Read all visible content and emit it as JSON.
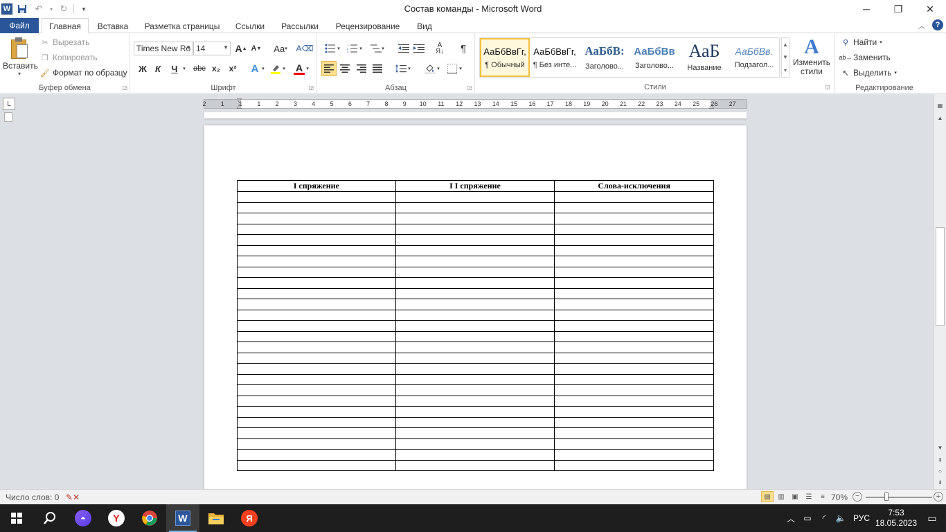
{
  "window": {
    "title": "Состав команды  -  Microsoft Word",
    "app_icon": "W",
    "controls": [
      "minimize",
      "restore",
      "close"
    ]
  },
  "tabs": {
    "file": "Файл",
    "items": [
      "Главная",
      "Вставка",
      "Разметка страницы",
      "Ссылки",
      "Рассылки",
      "Рецензирование",
      "Вид"
    ],
    "active": "Главная"
  },
  "ribbon": {
    "clipboard": {
      "label": "Буфер обмена",
      "paste": "Вставить",
      "cut": "Вырезать",
      "copy": "Копировать",
      "format_painter": "Формат по образцу"
    },
    "font": {
      "label": "Шрифт",
      "family": "Times New Ro",
      "size": "14",
      "bold": "Ж",
      "italic": "К",
      "underline": "Ч",
      "strikethrough": "abc",
      "subscript": "x₂",
      "superscript": "x²",
      "grow": "A",
      "shrink": "A",
      "change_case": "Aa"
    },
    "paragraph": {
      "label": "Абзац"
    },
    "styles": {
      "label": "Стили",
      "items": [
        {
          "preview": "АаБбВвГг,",
          "name": "¶ Обычный",
          "active": true
        },
        {
          "preview": "АаБбВвГг,",
          "name": "¶ Без инте..."
        },
        {
          "preview": "АаБбВ:",
          "name": "Заголово..."
        },
        {
          "preview": "АаБбВв",
          "name": "Заголово..."
        },
        {
          "preview": "АаБ",
          "name": "Название"
        },
        {
          "preview": "АаБбВв.",
          "name": "Подзагол..."
        }
      ],
      "change_styles": "Изменить стили"
    },
    "editing": {
      "label": "Редактирование",
      "find": "Найти",
      "replace": "Заменить",
      "select": "Выделить"
    }
  },
  "ruler": {
    "numbers": [
      "2",
      "1",
      "1",
      "1",
      "2",
      "3",
      "4",
      "5",
      "6",
      "7",
      "8",
      "9",
      "10",
      "11",
      "12",
      "13",
      "14",
      "15",
      "16",
      "17",
      "18",
      "19",
      "20",
      "21",
      "22",
      "23",
      "24",
      "25",
      "26",
      "27"
    ]
  },
  "document": {
    "table": {
      "headers": [
        "I спряжение",
        "I I спряжение",
        "Слова-исключения"
      ],
      "empty_rows": 26
    }
  },
  "statusbar": {
    "word_count": "Число слов: 0",
    "zoom": "70%"
  },
  "taskbar": {
    "tray_lang": "РУС",
    "time": "7:53",
    "date": "18.05.2023"
  }
}
